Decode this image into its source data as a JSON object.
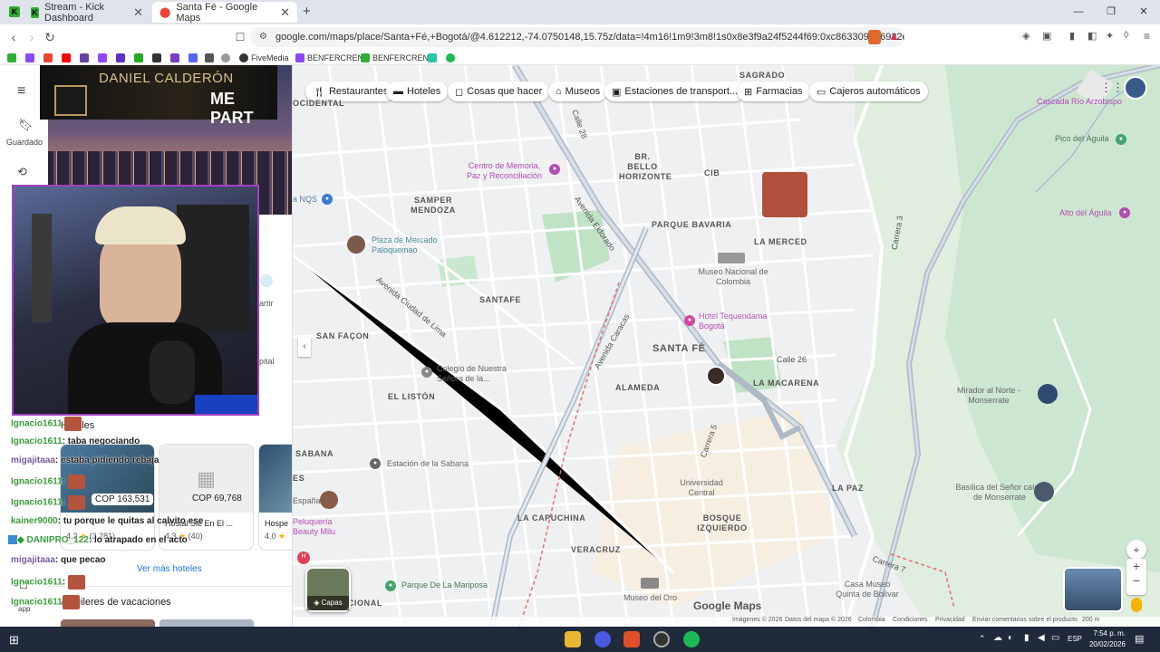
{
  "tabs": [
    {
      "title": "Stream - Kick Dashboard"
    },
    {
      "title": "Santa Fé - Google Maps"
    }
  ],
  "new_tab_symbol": "+",
  "window_controls": {
    "minimize": "—",
    "restore": "❐",
    "close": "✕"
  },
  "address_bar": {
    "url": "google.com/maps/place/Santa+Fé,+Bogotá/@4.612212,-74.0750148,15.75z/data=!4m16!1m9!3m8!1s0x8e3f9a24f5244f69:0xc863309eb6922ea..."
  },
  "bookmarks": [
    {
      "label": "FiveMedia"
    },
    {
      "label": "BENFERCREN"
    },
    {
      "label": "BENFERCREN"
    }
  ],
  "maps_rail": {
    "saved_label": "Guardado",
    "app_label": "app"
  },
  "overlay": {
    "name": "DANIEL CALDERÓN",
    "subtitle": "ME PART"
  },
  "side_panel": {
    "share_fragment": "artir",
    "capital_fragment": "pital",
    "hotels_heading": "Hoteles",
    "hotels": [
      {
        "price": "COP 163,531",
        "rating": "4.3",
        "reviews": "(3,281)"
      },
      {
        "price": "COP 69,768",
        "name": "Hostal Sie En El ...",
        "rating": "4.3",
        "reviews": "(40)"
      },
      {
        "name": "Hospe",
        "rating": "4.0"
      }
    ],
    "more_hotels": "Ver más hoteles",
    "vacation_label": "Alquileres de vacaciones"
  },
  "chat": [
    {
      "user": "Ignacio1611",
      "text": ""
    },
    {
      "user": "Ignacio1611",
      "text": ": taba negociando"
    },
    {
      "user": "migajitaaa",
      "text": ": estaba pidiendo rebaja"
    },
    {
      "user": "Ignacio1611",
      "text": ": "
    },
    {
      "user": "Ignacio1611",
      "text": ": "
    },
    {
      "user": "kainer9000",
      "text": ": tu porque le quitas al calvito ese"
    },
    {
      "user": "DANIPRO_122",
      "text": ": lo atrapado en el acto"
    },
    {
      "user": "migajitaaa",
      "text": ": que pecao"
    },
    {
      "user": "Ignacio1611",
      "text": ": "
    },
    {
      "user": "Ignacio1611",
      "text": ""
    }
  ],
  "map": {
    "chips": [
      {
        "label": "Restaurantes"
      },
      {
        "label": "Hoteles"
      },
      {
        "label": "Cosas que hacer"
      },
      {
        "label": "Museos"
      },
      {
        "label": "Estaciones de transport..."
      },
      {
        "label": "Farmacias"
      },
      {
        "label": "Cajeros automáticos"
      }
    ],
    "neighborhoods": [
      "SAGRADO",
      "BR. BELLO HORIZONTE",
      "CIB",
      "SAMPER MENDOZA",
      "PARQUE BAVARIA",
      "LA MERCED",
      "SANTAFE",
      "SAN FAÇON",
      "SANTA FÉ",
      "EL LISTÓN",
      "ALAMEDA",
      "LA MACARENA",
      "SABANA",
      "LA PAZ",
      "LA CAPUCHINA",
      "BOSQUE IZQUIERDO",
      "VERACRUZ",
      "OCIDENTAL",
      "TO NACIONAL",
      "ES"
    ],
    "pois": [
      "Cascada Río Arzobispo",
      "Pico del Águila",
      "Alto del Águila",
      "Centro de Memoria, Paz y Reconciliación",
      "Plaza de Mercado Paloquemao",
      "Museo Nacional de Colombia",
      "Hotel Tequendama Bogotá",
      "Colegio de Nuestra Señora de la...",
      "Estación de la Sabana",
      "Universidad Central",
      "Mirador al Norte - Monserrate",
      "Basílica del Señor caído de Monserrate",
      "Parque De La Mariposa",
      "Museo del Oro",
      "Casa Museo Quinta de Bolívar",
      "Peluquería Beauty Milu",
      "España",
      "a NQS"
    ],
    "streets": [
      "Avenida Ciudad de Lima",
      "Avenida Caracas",
      "Avenida Eldorado",
      "Carrera 7",
      "Calle 26",
      "Carrera 3",
      "Calle 28",
      "Carrera 5"
    ],
    "layers_label": "Capas",
    "brand": "Google Maps",
    "footer": [
      "Imágenes © 2026",
      "Datos del mapa © 2026",
      "Colombia",
      "Condiciones",
      "Privacidad",
      "Enviar comentarios sobre el producto",
      "200 m"
    ]
  },
  "taskbar": {
    "time": "7:54 p. m.",
    "date": "20/02/2026",
    "lang": "ESP"
  }
}
